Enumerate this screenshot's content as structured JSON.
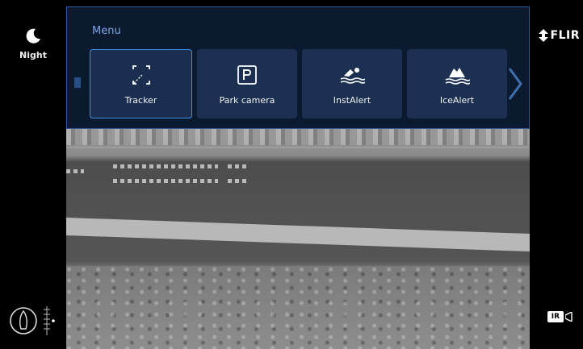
{
  "menu": {
    "title": "Menu",
    "items": [
      {
        "label": "Tracker",
        "icon": "tracker-icon",
        "active": true
      },
      {
        "label": "Park camera",
        "icon": "park-camera-icon",
        "active": false
      },
      {
        "label": "InstAlert",
        "icon": "swimmer-icon",
        "active": false
      },
      {
        "label": "IceAlert",
        "icon": "iceberg-icon",
        "active": false
      }
    ]
  },
  "left": {
    "night_label": "Night",
    "night_icon": "moon-icon",
    "pan_icon": "vessel-heading-icon"
  },
  "right": {
    "brand": "FLIR",
    "brand_icon": "flir-logo-icon",
    "mode_label": "IR",
    "mode_icon": "camera-icon"
  },
  "colors": {
    "panel": "#0c1a30",
    "tile": "#1c3052",
    "accent": "#3f8fe6",
    "menu_title": "#7fa8e8"
  }
}
